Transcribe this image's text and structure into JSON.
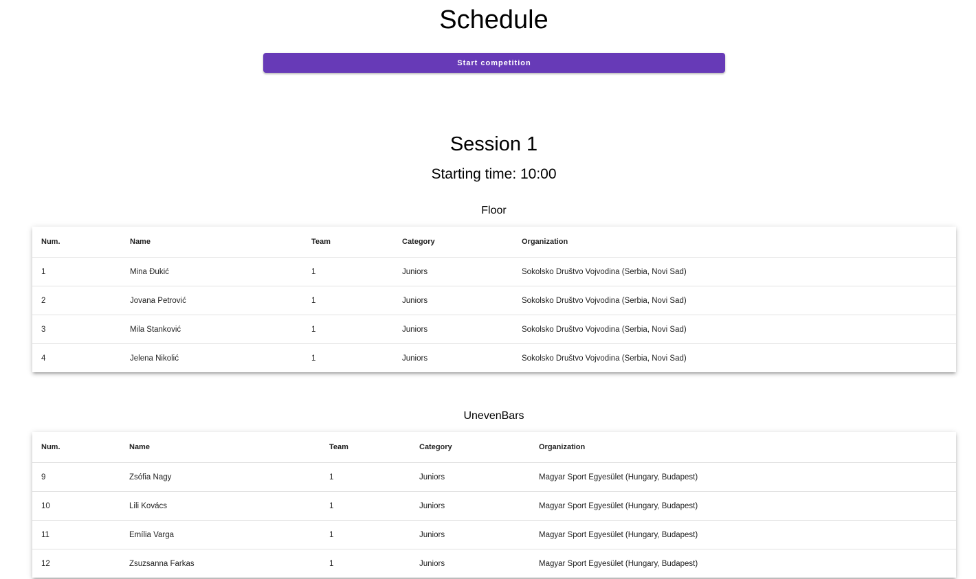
{
  "page": {
    "title": "Schedule",
    "start_button_label": "Start competition"
  },
  "session": {
    "title": "Session 1",
    "starting_time": "Starting time: 10:00"
  },
  "columns": [
    "Num.",
    "Name",
    "Team",
    "Category",
    "Organization"
  ],
  "apparatus": [
    {
      "name": "Floor",
      "rows": [
        {
          "num": "1",
          "name": "Mina Đukić",
          "team": "1",
          "category": "Juniors",
          "organization": "Sokolsko Društvo Vojvodina (Serbia, Novi Sad)"
        },
        {
          "num": "2",
          "name": "Jovana Petrović",
          "team": "1",
          "category": "Juniors",
          "organization": "Sokolsko Društvo Vojvodina (Serbia, Novi Sad)"
        },
        {
          "num": "3",
          "name": "Mila Stanković",
          "team": "1",
          "category": "Juniors",
          "organization": "Sokolsko Društvo Vojvodina (Serbia, Novi Sad)"
        },
        {
          "num": "4",
          "name": "Jelena Nikolić",
          "team": "1",
          "category": "Juniors",
          "organization": "Sokolsko Društvo Vojvodina (Serbia, Novi Sad)"
        }
      ]
    },
    {
      "name": "UnevenBars",
      "rows": [
        {
          "num": "9",
          "name": "Zsófia Nagy",
          "team": "1",
          "category": "Juniors",
          "organization": "Magyar Sport Egyesület (Hungary, Budapest)"
        },
        {
          "num": "10",
          "name": "Lili Kovács",
          "team": "1",
          "category": "Juniors",
          "organization": "Magyar Sport Egyesület (Hungary, Budapest)"
        },
        {
          "num": "11",
          "name": "Emília Varga",
          "team": "1",
          "category": "Juniors",
          "organization": "Magyar Sport Egyesület (Hungary, Budapest)"
        },
        {
          "num": "12",
          "name": "Zsuzsanna Farkas",
          "team": "1",
          "category": "Juniors",
          "organization": "Magyar Sport Egyesület (Hungary, Budapest)"
        }
      ]
    }
  ],
  "colors": {
    "primary": "#673ab7"
  }
}
